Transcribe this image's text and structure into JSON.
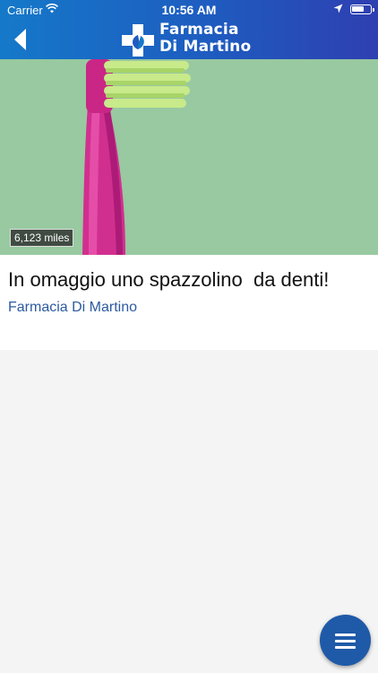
{
  "status_bar": {
    "carrier": "Carrier",
    "time": "10:56 AM"
  },
  "header": {
    "logo_line1": "Farmacia",
    "logo_line2": "Di Martino",
    "brand_color_left": "#1579c9",
    "brand_color_right": "#2f3fb1"
  },
  "post": {
    "distance": "6,123 miles",
    "title": "In omaggio uno spazzolino  da denti!",
    "author": "Farmacia Di Martino",
    "image_subject": "pink toothbrush on green background",
    "author_color": "#2c5aa0"
  },
  "fab": {
    "icon": "hamburger-menu-icon",
    "color": "#1f5aa8"
  }
}
